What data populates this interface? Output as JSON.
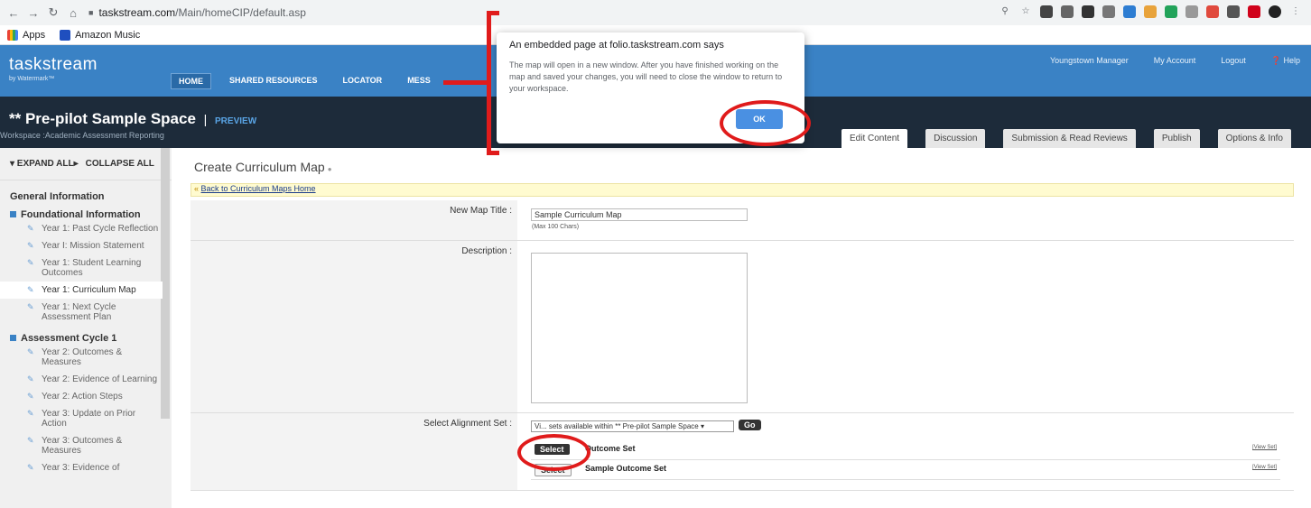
{
  "browser": {
    "url_host": "taskstream.com",
    "url_path": "/Main/homeCIP/default.asp",
    "bookmarks": [
      "Apps",
      "Amazon Music"
    ]
  },
  "app_nav": {
    "logo": "taskstream",
    "logo_sub": "by Watermark™",
    "items": [
      "HOME",
      "SHARED RESOURCES",
      "LOCATOR",
      "MESS"
    ],
    "util": [
      "Youngstown Manager",
      "My Account",
      "Logout",
      "❓ Help"
    ]
  },
  "workspace": {
    "title": "** Pre-pilot Sample Space",
    "pipe": "|",
    "preview": "PREVIEW",
    "subtitle": "Workspace :Academic Assessment Reporting",
    "tabs": [
      "Edit Content",
      "Discussion",
      "Submission & Read Reviews",
      "Publish",
      "Options & Info"
    ]
  },
  "sidebar": {
    "expand_all": "▾ EXPAND ALL▸",
    "collapse_all": "COLLAPSE ALL",
    "general": "General Information",
    "sections": [
      {
        "title": "Foundational Information",
        "items": [
          "Year 1: Past Cycle Reflection",
          "Year I: Mission Statement",
          "Year 1: Student Learning Outcomes",
          "Year 1: Curriculum Map",
          "Year 1: Next Cycle Assessment Plan"
        ]
      },
      {
        "title": "Assessment Cycle 1",
        "items": [
          "Year 2: Outcomes & Measures",
          "Year 2: Evidence of Learning",
          "Year 2: Action Steps",
          "Year 3: Update on Prior Action",
          "Year 3: Outcomes & Measures",
          "Year 3: Evidence of"
        ]
      }
    ]
  },
  "content": {
    "page_title": "Create Curriculum Map",
    "back_link": "Back to Curriculum Maps Home",
    "map_title_label": "New Map Title :",
    "map_title_value": "Sample Curriculum Map",
    "max_chars": "(Max 100 Chars)",
    "description_label": "Description :",
    "alignment_label": "Select Alignment Set :",
    "alignment_select": "Vi... sets available within ** Pre-pilot Sample Space ▾",
    "go": "Go",
    "outcome_sets": [
      {
        "button": "Select",
        "name": "Outcome Set",
        "view": "[View Set]"
      },
      {
        "button": "Select",
        "name": "Sample Outcome Set",
        "view": "[View Set]"
      }
    ]
  },
  "dialog": {
    "title": "An embedded page at folio.taskstream.com says",
    "message": "The map will open in a new window. After you have finished working on the map and saved your changes, you will need to close the window to return to your workspace.",
    "ok": "OK"
  },
  "colors": {
    "nav_blue": "#3a82c5",
    "header_dark": "#1d2b3a",
    "annotation_red": "#e01b1b"
  }
}
